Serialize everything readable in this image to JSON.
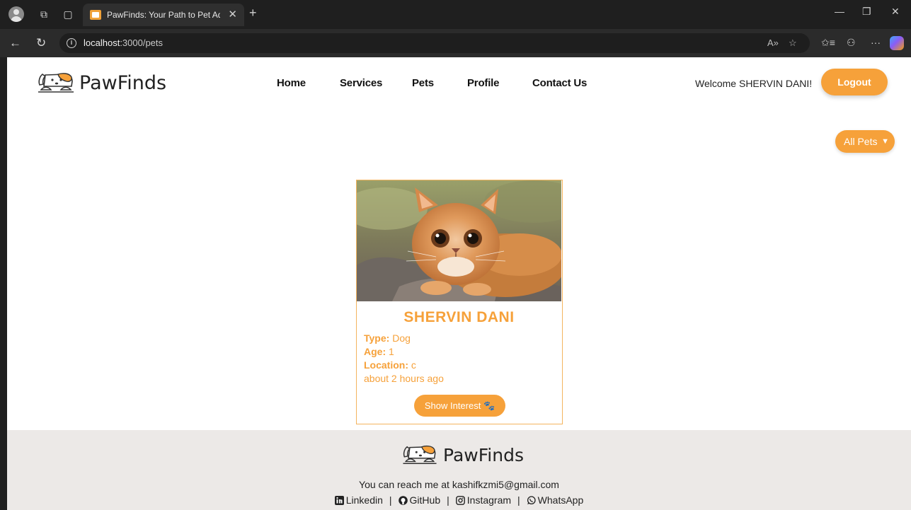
{
  "browser": {
    "tab_title": "PawFinds: Your Path to Pet Adopti",
    "url_host": "localhost",
    "url_path": ":3000/pets"
  },
  "site": {
    "brand": "PawFinds",
    "nav": [
      "Home",
      "Services",
      "Pets",
      "Profile",
      "Contact Us"
    ],
    "welcome": "Welcome SHERVIN DANI!",
    "logout_label": "Logout",
    "filter_label": "All Pets"
  },
  "pet_card": {
    "name": "SHERVIN DANI",
    "type_label": "Type:",
    "type_value": "Dog",
    "age_label": "Age:",
    "age_value": "1",
    "location_label": "Location:",
    "location_value": "c",
    "posted": "about 2 hours ago",
    "button_label": "Show Interest"
  },
  "footer": {
    "brand": "PawFinds",
    "contact": "You can reach me at kashifkzmi5@gmail.com",
    "links": [
      "Linkedin",
      "GitHub",
      "Instagram",
      "WhatsApp"
    ],
    "separator": "|"
  },
  "colors": {
    "accent": "#f6a13a",
    "footer_bg": "#ece9e7",
    "chrome_bg": "#1f1f1f"
  }
}
